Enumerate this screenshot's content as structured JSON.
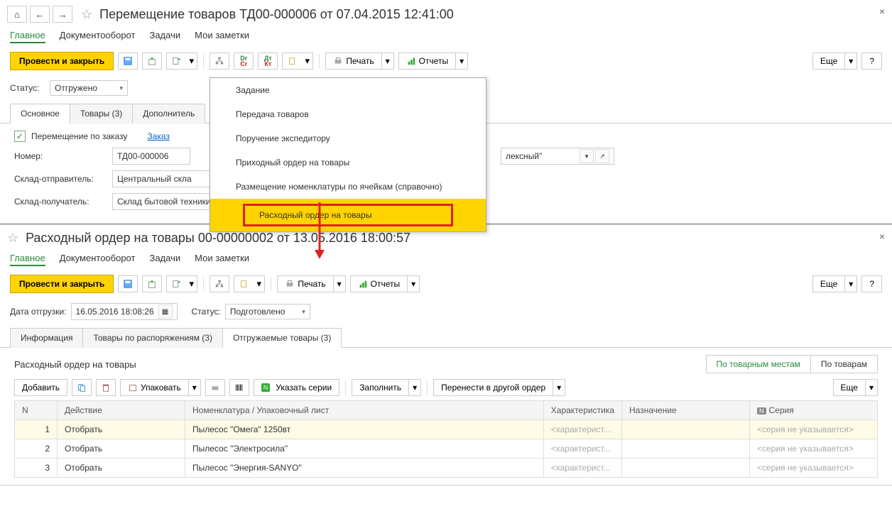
{
  "window1": {
    "title": "Перемещение товаров ТД00-000006 от 07.04.2015 12:41:00",
    "tabs": [
      "Главное",
      "Документооборот",
      "Задачи",
      "Мои заметки"
    ],
    "btn_post_close": "Провести и закрыть",
    "btn_print": "Печать",
    "btn_reports": "Отчеты",
    "btn_more": "Еще",
    "btn_help": "?",
    "status_label": "Статус:",
    "status_value": "Отгружено",
    "inner_tabs": [
      "Основное",
      "Товары (3)",
      "Дополнитель"
    ],
    "check_label": "Перемещение по заказу",
    "order_link": "Заказ",
    "num_label": "Номер:",
    "num_value": "ТД00-000006",
    "sender_label": "Склад-отправитель:",
    "sender_value": "Центральный скла",
    "receiver_label": "Склад-получатель:",
    "receiver_value": "Склад бытовой техники",
    "right_field_value": "лексный\"",
    "menu": [
      "Задание",
      "Передача товаров",
      "Поручение экспедитору",
      "Приходный ордер на товары",
      "Размещение номенклатуры по ячейкам (справочно)",
      "Расходный ордер на товары"
    ]
  },
  "window2": {
    "title": "Расходный ордер на товары 00-00000002 от 13.05.2016 18:00:57",
    "tabs": [
      "Главное",
      "Документооборот",
      "Задачи",
      "Мои заметки"
    ],
    "btn_post_close": "Провести и закрыть",
    "btn_print": "Печать",
    "btn_reports": "Отчеты",
    "btn_more": "Еще",
    "btn_help": "?",
    "ship_date_label": "Дата отгрузки:",
    "ship_date_value": "16.05.2016 18:08:26",
    "status_label": "Статус:",
    "status_value": "Подготовлено",
    "inner_tabs": [
      "Информация",
      "Товары по распоряжениям (3)",
      "Отгружаемые товары (3)"
    ],
    "table_title": "Расходный ордер на товары",
    "toggle_places": "По товарным местам",
    "toggle_goods": "По товарам",
    "btn_add": "Добавить",
    "btn_pack": "Упаковать",
    "btn_series": "Указать серии",
    "btn_fill": "Заполнить",
    "btn_move": "Перенести в другой ордер",
    "columns": [
      "N",
      "Действие",
      "Номенклатура / Упаковочный лист",
      "Характеристика",
      "Назначение",
      "Серия"
    ],
    "series_icon_col": "N",
    "rows": [
      {
        "n": "1",
        "action": "Отобрать",
        "nom": "Пылесос \"Омега\" 1250вт",
        "char": "<характерист...",
        "series": "<серия не указывается>"
      },
      {
        "n": "2",
        "action": "Отобрать",
        "nom": "Пылесос \"Электросила\"",
        "char": "<характерист...",
        "series": "<серия не указывается>"
      },
      {
        "n": "3",
        "action": "Отобрать",
        "nom": "Пылесос \"Энергия-SANYO\"",
        "char": "<характерист...",
        "series": "<серия не указывается>"
      }
    ]
  }
}
